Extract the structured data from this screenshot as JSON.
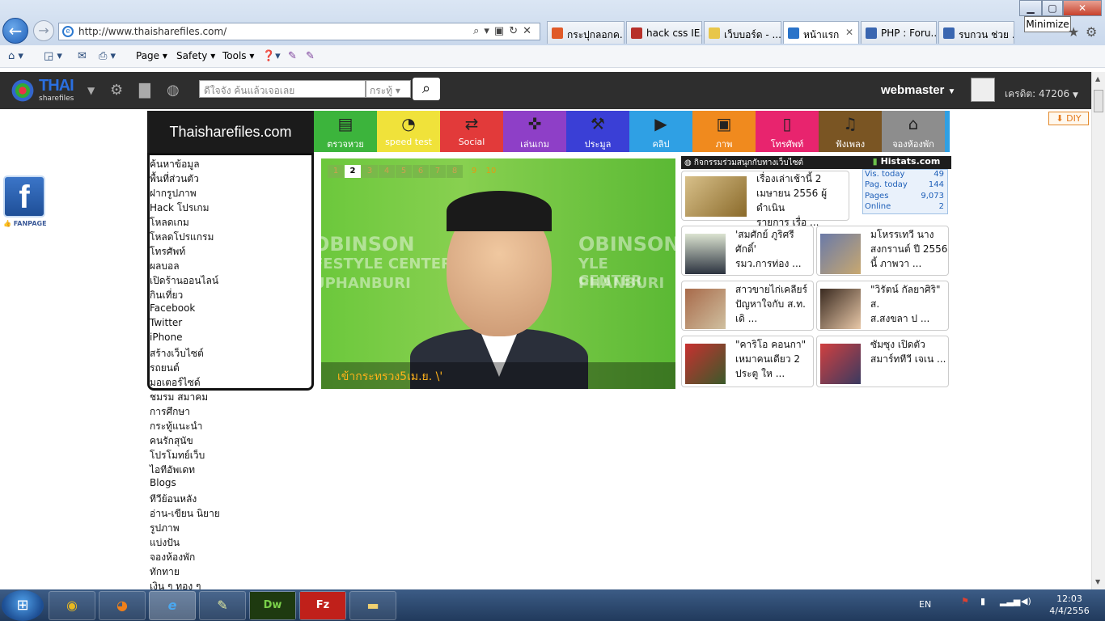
{
  "browser": {
    "url": "http://www.thaisharefiles.com/",
    "tabs": [
      {
        "label": "กระปุกลอกค...",
        "color": "#e05a28"
      },
      {
        "label": "hack css IE...",
        "color": "#b7312b"
      },
      {
        "label": "เว็บบอร์ด - ...",
        "color": "#e8c64a"
      },
      {
        "label": "หน้าแรก",
        "color": "#2a73c9"
      },
      {
        "label": "PHP : Foru...",
        "color": "#3a66b0"
      },
      {
        "label": "รบกวน ช่วย ...",
        "color": "#3a66b0"
      }
    ],
    "tooltip": "Minimize",
    "commands": {
      "page": "Page",
      "safety": "Safety",
      "tools": "Tools"
    }
  },
  "site": {
    "logo_main": "THAI",
    "logo_sub": "sharefiles",
    "search_placeholder": "ดีใจจัง ค้นแล้วเจอเลย",
    "search_scope": "กระทู้",
    "username": "webmaster",
    "credit": "เครดิต: 47206",
    "brand": "Thaisharefiles.com",
    "diy": "DIY",
    "fanpage": "FANPAGE",
    "facebook_letter": "f"
  },
  "categories": [
    {
      "label": "ตรวจหวย",
      "color": "#3cb43c",
      "icon": "lottery-icon",
      "glyph": "▤"
    },
    {
      "label": "speed test",
      "color": "#f0e23a",
      "icon": "speedometer-icon",
      "glyph": "◔"
    },
    {
      "label": "Social",
      "color": "#e23a3a",
      "icon": "shuffle-icon",
      "glyph": "⇄"
    },
    {
      "label": "เล่นเกม",
      "color": "#8e3fc7",
      "icon": "gamepad-icon",
      "glyph": "✜"
    },
    {
      "label": "ประมูล",
      "color": "#3a3fd6",
      "icon": "gavel-icon",
      "glyph": "⚒"
    },
    {
      "label": "คลิป",
      "color": "#2fa0e4",
      "icon": "video-camera-icon",
      "glyph": "▶"
    },
    {
      "label": "ภาพ",
      "color": "#f08a1e",
      "icon": "picture-icon",
      "glyph": "▣"
    },
    {
      "label": "โทรศัพท์",
      "color": "#e8246e",
      "icon": "phone-icon",
      "glyph": "▯"
    },
    {
      "label": "ฟังเพลง",
      "color": "#7a5523",
      "icon": "music-icon",
      "glyph": "♫"
    },
    {
      "label": "จองห้องพัก",
      "color": "#8d8d8d",
      "icon": "hotel-bed-icon",
      "glyph": "⌂"
    }
  ],
  "menu": [
    "ค้นหาข้อมูล",
    "พื้นที่ส่วนตัว",
    "ฝากรูปภาพ",
    "Hack โปรเกม",
    "โหลดเกม",
    "โหลดโปรแกรม",
    "โทรศัพท์",
    "ผลบอล",
    "เปิดร้านออนไลน์",
    "กินเที่ยว",
    "Facebook",
    "Twitter",
    "iPhone",
    "สร้างเว็บไซต์",
    "รถยนต์",
    "มอเตอร์ไซด์",
    "ชมรม สมาคม",
    "การศึกษา",
    "กระทู้แนะนำ",
    "คนรักสุนัข",
    "โปรโมทย์เว็บ",
    "ไอทีอัพเดท",
    "Blogs",
    "ทีวีย้อนหลัง",
    "อ่าน-เขียน นิยาย",
    "รูปภาพ",
    "แบ่งปัน",
    "จองห้องพัก",
    "ทักทาย",
    "เงิน ๆ ทอง ๆ"
  ],
  "slider": {
    "pages": [
      "1",
      "2",
      "3",
      "4",
      "5",
      "6",
      "7",
      "8",
      "9",
      "10"
    ],
    "current": 2,
    "caption": "เข้ากระทรวง5เม.ย. \\'",
    "bg_text_1": "OBINSON",
    "bg_text_2": "FESTYLE CENTER",
    "bg_text_3": "UPHANBURI",
    "bg_text_4": "OBINSON",
    "bg_text_5": "YLE CENTER",
    "bg_text_6": "PHANBURI"
  },
  "activity_header": "กิจกรรมร่วมสนุกกับทางเว็บไซต์",
  "histats": {
    "title": "Histats.com",
    "rows": [
      {
        "label": "Vis. today",
        "value": "49"
      },
      {
        "label": "Pag. today",
        "value": "144"
      },
      {
        "label": "Pages",
        "value": "9,073"
      },
      {
        "label": "Online",
        "value": "2"
      }
    ]
  },
  "news": [
    {
      "lines": [
        "เรื่องเล่าเช้านี้ 2",
        "เมษายน 2556 ผู้ดำเนิน",
        "รายการ เรื่อ ..."
      ]
    },
    {
      "lines": [
        "'สมศักย์ ภูริศรีศักดิ์'",
        "รมว.การท่อง ..."
      ]
    },
    {
      "lines": [
        "มโหรรเทวี นาง",
        "สงกรานต์ ปี 2556",
        "นี้ ภาพวา ..."
      ]
    },
    {
      "lines": [
        "สาวขายไก่เคลียร์",
        "ปัญหาใจกับ ส.ท.",
        "เดิ ..."
      ]
    },
    {
      "lines": [
        "\"วิรัตน์ กัลยาศิริ\" ส.",
        "ส.สงขลา ป ..."
      ]
    },
    {
      "lines": [
        "\"คาริโอ คอนกา\"",
        "เหมาคนเดียว 2",
        "ประตู ให ..."
      ]
    },
    {
      "lines": [
        "ซัมซุง เปิดตัว",
        "สมาร์ททีวี เจเน ..."
      ]
    }
  ],
  "taskbar": {
    "lang": "EN",
    "time": "12:03",
    "date": "4/4/2556",
    "dw": "Dw",
    "fz": "Fz"
  }
}
